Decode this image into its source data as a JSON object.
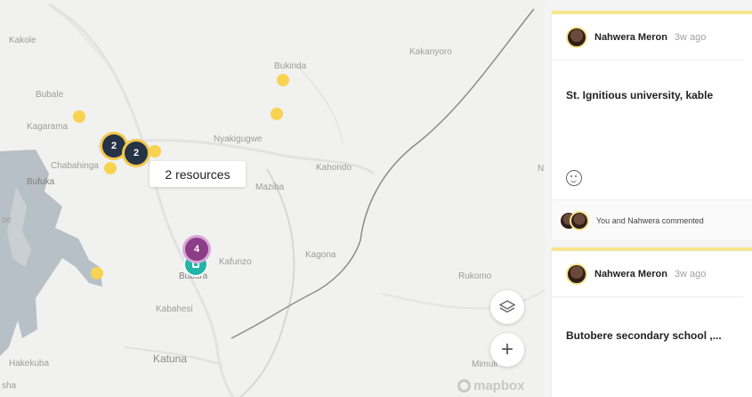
{
  "map": {
    "places": [
      "Kakole",
      "Kakanyoro",
      "Bukinda",
      "Bubale",
      "Kagarama",
      "Nyakigugwe",
      "Chabahinga",
      "Bufuka",
      "Kahondo",
      "Maziba",
      "Kafunzo",
      "Kagona",
      "Bubara",
      "Kabahesi",
      "Rukomo",
      "Hakekuba",
      "Katuna",
      "Mimuli",
      "se",
      "sha",
      "N"
    ],
    "clusters": [
      "2",
      "2",
      "4"
    ],
    "tooltip": "2 resources",
    "layers_button": "layers-icon",
    "zoom_in_label": "+",
    "attribution": "mapbox"
  },
  "colors": {
    "accent_yellow": "#f7d352",
    "cluster_dark": "#263245",
    "cluster_purple": "#8b3d87",
    "teal": "#22b5a8",
    "water": "#b7c0c6"
  },
  "comments": [
    {
      "author": "Nahwera Meron",
      "time": "3w ago",
      "text": "St. Ignitious university, kable",
      "reaction_icon": "smiley-icon",
      "footer": "You and Nahwera commented"
    },
    {
      "author": "Nahwera Meron",
      "time": "3w ago",
      "text": "Butobere secondary school ,..."
    }
  ]
}
